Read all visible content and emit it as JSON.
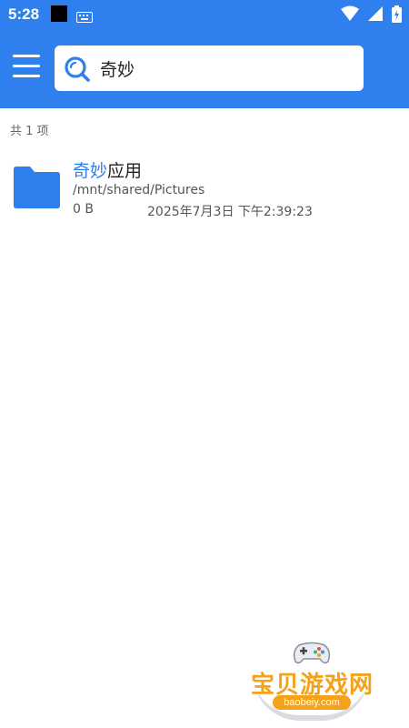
{
  "status_bar": {
    "time": "5:28",
    "icons": [
      "black-square-icon",
      "keyboard-icon",
      "wifi-icon",
      "signal-icon",
      "battery-icon"
    ]
  },
  "app_bar": {
    "menu_icon": "hamburger-menu-icon",
    "search": {
      "icon": "search-icon",
      "value": "奇妙"
    },
    "accent_color": "#2f80ee"
  },
  "results": {
    "count_label": "共 1 项",
    "items": [
      {
        "icon": "folder-icon",
        "name_highlight": "奇妙",
        "name_rest": "应用",
        "path": "/mnt/shared/Pictures",
        "size": "0 B",
        "modified": "2025年7月3日 下午2:39:23"
      }
    ]
  },
  "watermark": {
    "title": "宝贝游戏网",
    "url": "baobeiy.com"
  }
}
